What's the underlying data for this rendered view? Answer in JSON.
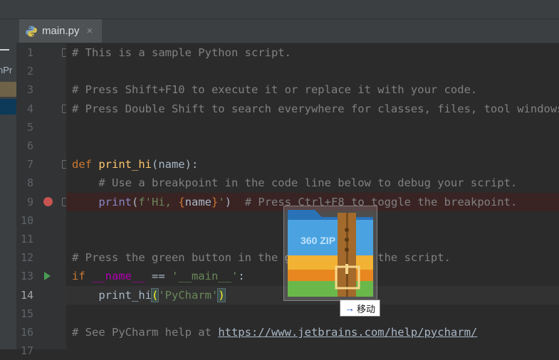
{
  "project_panel": {
    "label": "nPr"
  },
  "tab": {
    "label": "main.py",
    "close": "×"
  },
  "editor": {
    "lines": [
      {
        "num": "1",
        "segments": [
          {
            "t": "# This is a sample Python script.",
            "c": "cmt"
          }
        ]
      },
      {
        "num": "2",
        "segments": []
      },
      {
        "num": "3",
        "segments": [
          {
            "t": "# Press Shift+F10 to execute it or replace it with your code.",
            "c": "cmt"
          }
        ]
      },
      {
        "num": "4",
        "segments": [
          {
            "t": "# Press Double Shift to search everywhere for classes, files, tool windows, actions, and settings.",
            "c": "cmt"
          }
        ]
      },
      {
        "num": "5",
        "segments": []
      },
      {
        "num": "6",
        "segments": []
      },
      {
        "num": "7",
        "segments": [
          {
            "t": "def ",
            "c": "kw"
          },
          {
            "t": "print_hi",
            "c": "fn"
          },
          {
            "t": "(name):",
            "c": ""
          }
        ]
      },
      {
        "num": "8",
        "segments": [
          {
            "t": "    # Use a breakpoint in the code line below to debug your script.",
            "c": "cmt"
          }
        ]
      },
      {
        "num": "9",
        "segments": [
          {
            "t": "    ",
            "c": ""
          },
          {
            "t": "print",
            "c": "bi"
          },
          {
            "t": "(",
            "c": ""
          },
          {
            "t": "f'Hi, ",
            "c": "str"
          },
          {
            "t": "{",
            "c": "kw"
          },
          {
            "t": "name",
            "c": ""
          },
          {
            "t": "}",
            "c": "kw"
          },
          {
            "t": "'",
            "c": "str"
          },
          {
            "t": ")  ",
            "c": ""
          },
          {
            "t": "# Press Ctrl+F8 to toggle the breakpoint.",
            "c": "cmt"
          }
        ]
      },
      {
        "num": "10",
        "segments": []
      },
      {
        "num": "11",
        "segments": []
      },
      {
        "num": "12",
        "segments": [
          {
            "t": "# Press the green button in the gutter to run the script.",
            "c": "cmt"
          }
        ]
      },
      {
        "num": "13",
        "segments": [
          {
            "t": "if ",
            "c": "kw"
          },
          {
            "t": "__name__",
            "c": "mag"
          },
          {
            "t": " == ",
            "c": ""
          },
          {
            "t": "'__main__'",
            "c": "str"
          },
          {
            "t": ":",
            "c": ""
          }
        ]
      },
      {
        "num": "14",
        "segments": [
          {
            "t": "    print_hi",
            "c": ""
          },
          {
            "t": "(",
            "c": "match"
          },
          {
            "t": "'PyCharm'",
            "c": "str"
          },
          {
            "t": ")",
            "c": "match"
          }
        ]
      },
      {
        "num": "15",
        "segments": []
      },
      {
        "num": "16",
        "segments": [
          {
            "t": "# See PyCharm help at ",
            "c": "cmt"
          },
          {
            "t": "https://www.jetbrains.com/help/pycharm/",
            "c": "url"
          }
        ]
      },
      {
        "num": "17",
        "segments": []
      }
    ]
  },
  "drag": {
    "icon_name": "360-zip-icon",
    "icon_text": "360 ZIP",
    "tooltip": "移动",
    "tooltip_arrow": "→"
  }
}
